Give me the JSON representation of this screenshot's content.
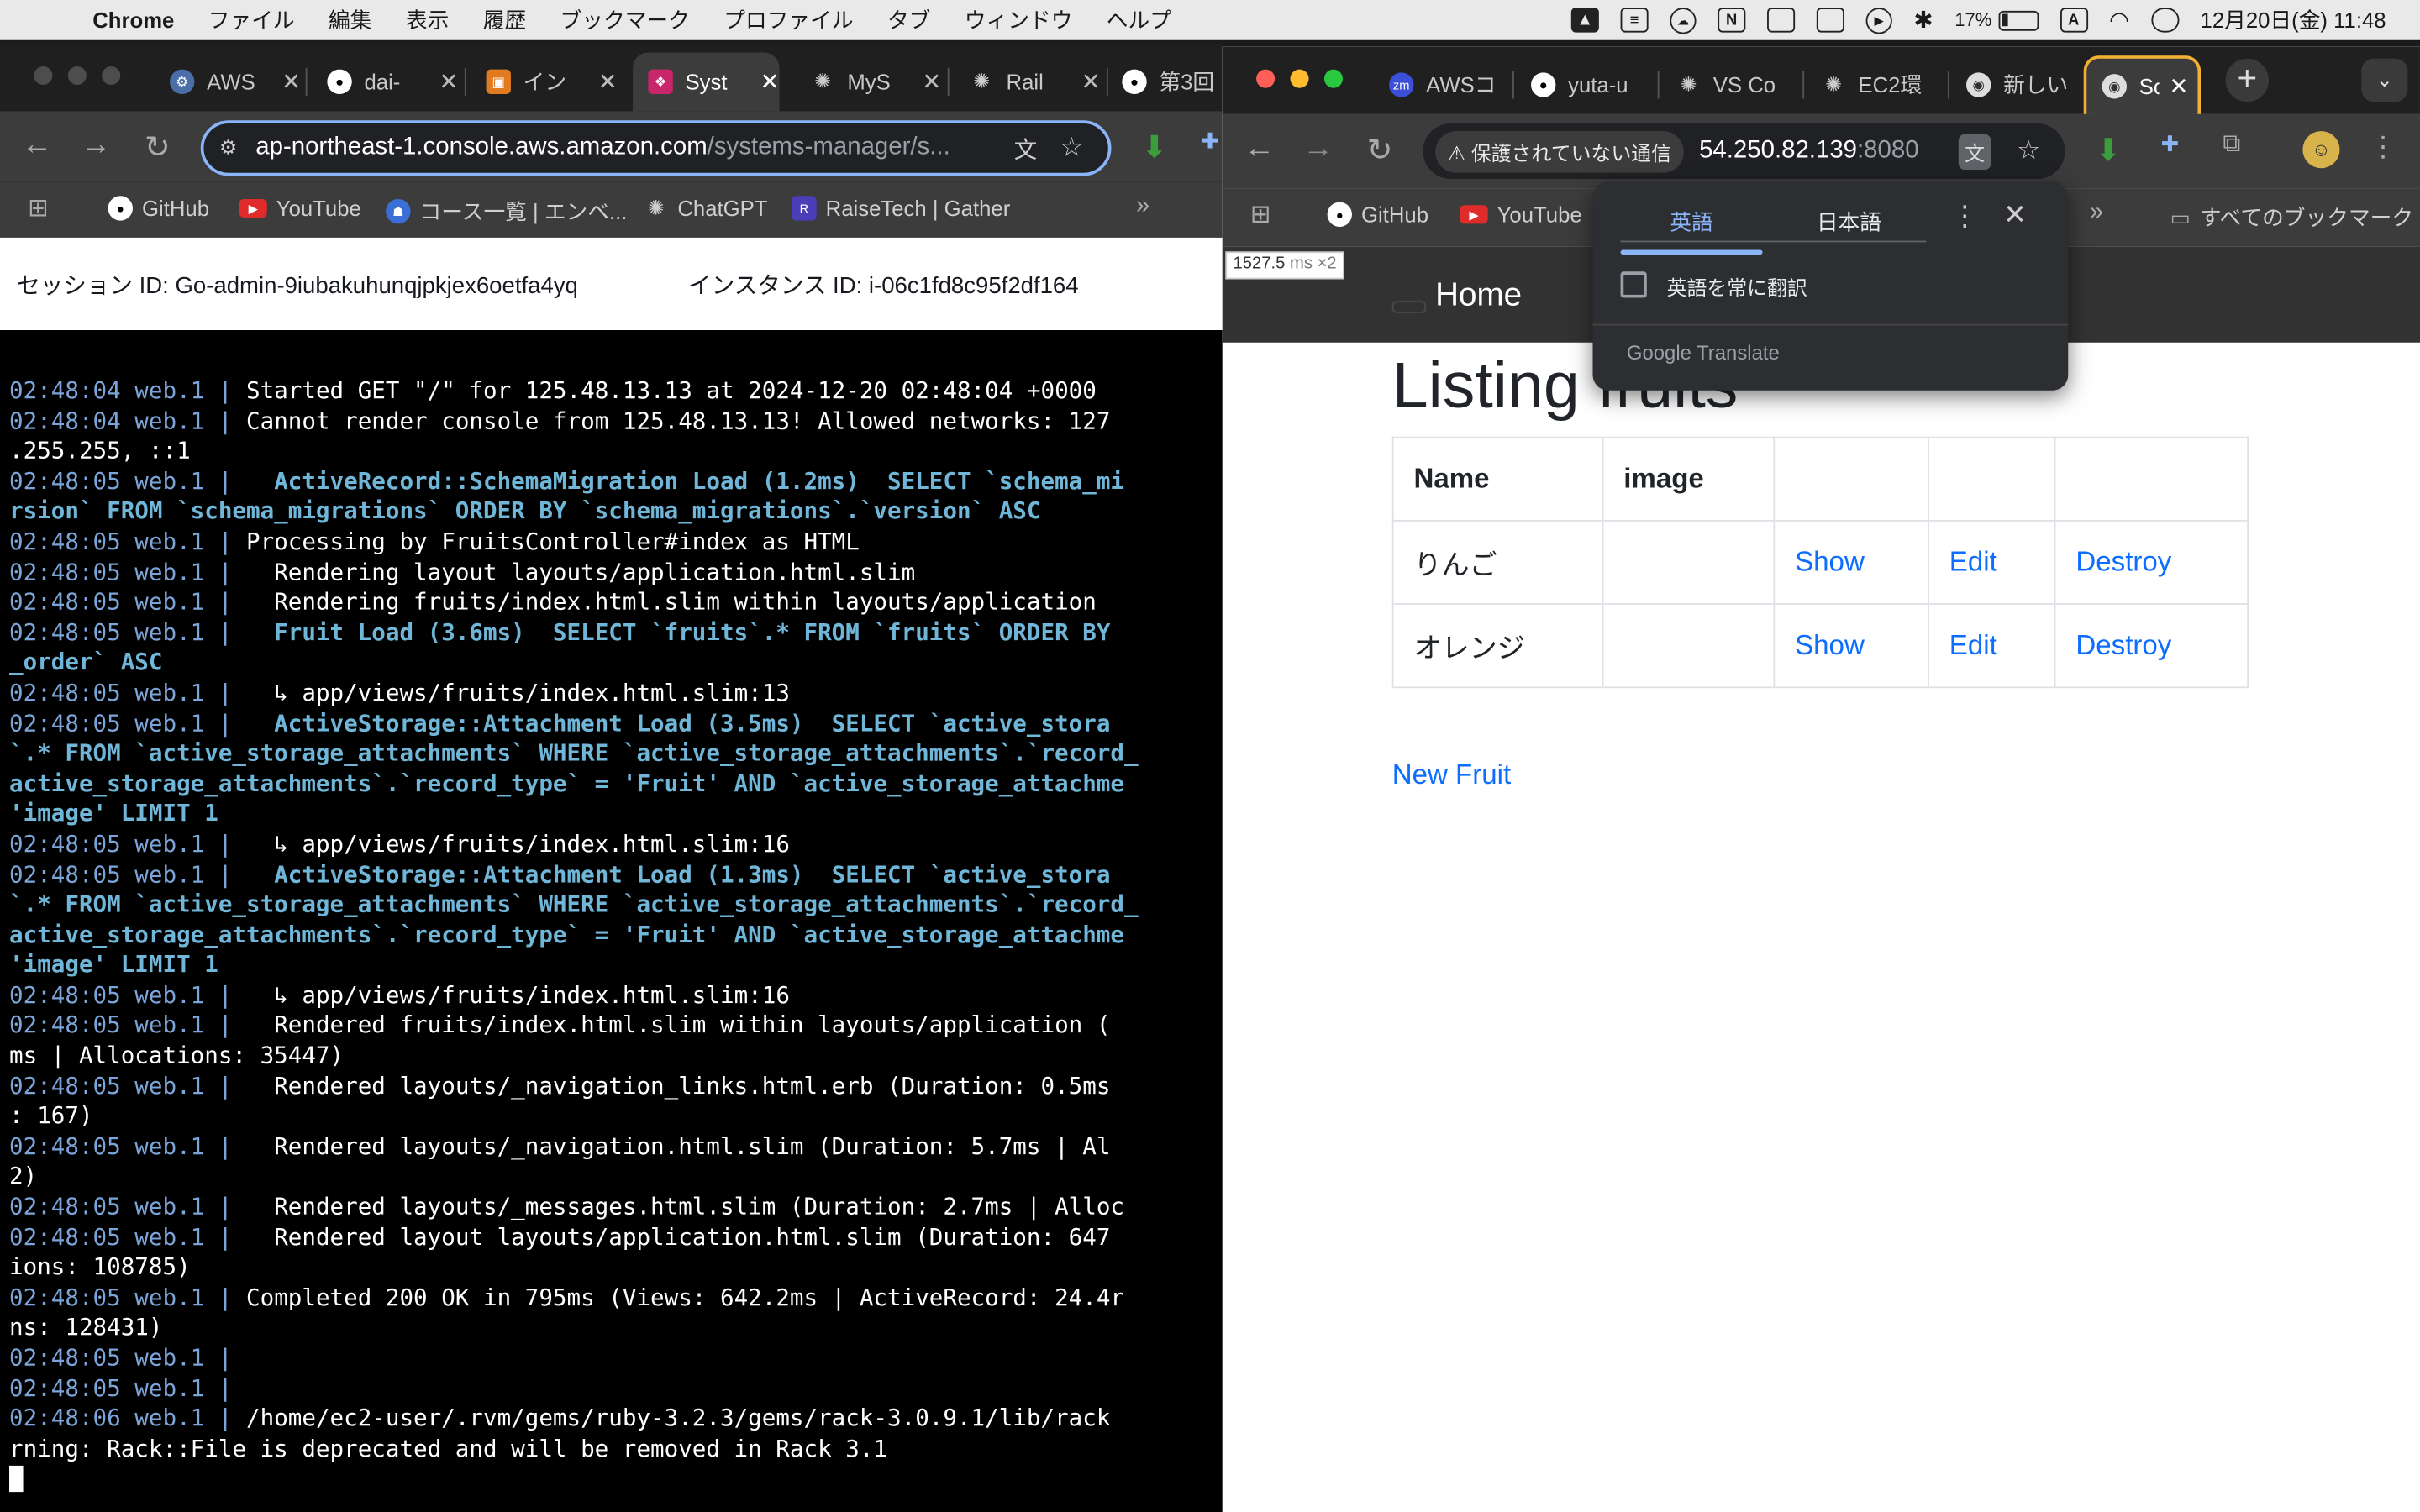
{
  "menubar": {
    "app_name": "Chrome",
    "items": [
      "ファイル",
      "編集",
      "表示",
      "履歴",
      "ブックマーク",
      "プロファイル",
      "タブ",
      "ウィンドウ",
      "ヘルプ"
    ],
    "battery_percent": "17%",
    "input_mode": "A",
    "clock": "12月20日(金) 11:48"
  },
  "left_window": {
    "tabs": [
      {
        "title": "AWS",
        "icon": "aws-systems-manager-icon",
        "color": "#4b6ea8"
      },
      {
        "title": "dai-",
        "icon": "github-icon",
        "color": "#ffffff"
      },
      {
        "title": "イン",
        "icon": "ec2-icon",
        "color": "#e07b22"
      },
      {
        "title": "Syst",
        "icon": "systems-manager-icon",
        "color": "#c9256a"
      },
      {
        "title": "MyS",
        "icon": "chatgpt-icon",
        "color": "#cccccc"
      },
      {
        "title": "Rail",
        "icon": "chatgpt-icon",
        "color": "#cccccc"
      },
      {
        "title": "第3回",
        "icon": "github-icon",
        "color": "#ffffff"
      }
    ],
    "active_tab_index": 3,
    "address_host": "ap-northeast-1.console.aws.amazon.com",
    "address_path": "/systems-manager/s...",
    "bookmarks": [
      {
        "label": "GitHub",
        "icon": "github-icon",
        "color": "#333333"
      },
      {
        "label": "YouTube",
        "icon": "youtube-icon",
        "color": "#e02b2b"
      },
      {
        "label": "コース一覧 | エンベ...",
        "icon": "course-icon",
        "color": "#3b6fd8"
      },
      {
        "label": "ChatGPT",
        "icon": "chatgpt-icon",
        "color": "#555555"
      },
      {
        "label": "RaiseTech | Gather",
        "icon": "raisetech-icon",
        "color": "#4a3fb8"
      }
    ],
    "session_id": "セッション ID: Go-admin-9iubakuhunqjpkjex6oetfa4yq",
    "instance_id": "インスタンス ID: i-06c1fd8c95f2df164"
  },
  "terminal": {
    "lines": [
      {
        "ts": "02:48:04 web.1",
        "sep": " | ",
        "text": "Started GET \"/\" for 125.48.13.13 at 2024-12-20 02:48:04 +0000"
      },
      {
        "ts": "02:48:04 web.1",
        "sep": " | ",
        "text": "Cannot render console from 125.48.13.13! Allowed networks: 127"
      },
      {
        "ts": "",
        "sep": "",
        "text": ".255.255, ::1"
      },
      {
        "ts": "02:48:05 web.1",
        "sep": " | ",
        "text": "  ",
        "sql": "ActiveRecord::SchemaMigration Load (1.2ms)  SELECT `schema_mi"
      },
      {
        "ts": "",
        "sep": "",
        "text": "",
        "sql": "rsion` FROM `schema_migrations` ORDER BY `schema_migrations`.`version` ASC"
      },
      {
        "ts": "02:48:05 web.1",
        "sep": " | ",
        "text": "Processing by FruitsController#index as HTML"
      },
      {
        "ts": "02:48:05 web.1",
        "sep": " | ",
        "text": "  Rendering layout layouts/application.html.slim"
      },
      {
        "ts": "02:48:05 web.1",
        "sep": " | ",
        "text": "  Rendering fruits/index.html.slim within layouts/application"
      },
      {
        "ts": "02:48:05 web.1",
        "sep": " | ",
        "text": "  ",
        "sql": "Fruit Load (3.6ms)  SELECT `fruits`.* FROM `fruits` ORDER BY"
      },
      {
        "ts": "",
        "sep": "",
        "text": "",
        "sql": "_order` ASC"
      },
      {
        "ts": "02:48:05 web.1",
        "sep": " | ",
        "text": "  ↳ app/views/fruits/index.html.slim:13"
      },
      {
        "ts": "02:48:05 web.1",
        "sep": " | ",
        "text": "  ",
        "sql": "ActiveStorage::Attachment Load (3.5ms)  SELECT `active_stora"
      },
      {
        "ts": "",
        "sep": "",
        "text": "",
        "sql": "`.* FROM `active_storage_attachments` WHERE `active_storage_attachments`.`record_"
      },
      {
        "ts": "",
        "sep": "",
        "text": "",
        "sql": "active_storage_attachments`.`record_type` = 'Fruit' AND `active_storage_attachme"
      },
      {
        "ts": "",
        "sep": "",
        "text": "",
        "sql": "'image' LIMIT 1"
      },
      {
        "ts": "02:48:05 web.1",
        "sep": " | ",
        "text": "  ↳ app/views/fruits/index.html.slim:16"
      },
      {
        "ts": "02:48:05 web.1",
        "sep": " | ",
        "text": "  ",
        "sql": "ActiveStorage::Attachment Load (1.3ms)  SELECT `active_stora"
      },
      {
        "ts": "",
        "sep": "",
        "text": "",
        "sql": "`.* FROM `active_storage_attachments` WHERE `active_storage_attachments`.`record_"
      },
      {
        "ts": "",
        "sep": "",
        "text": "",
        "sql": "active_storage_attachments`.`record_type` = 'Fruit' AND `active_storage_attachme"
      },
      {
        "ts": "",
        "sep": "",
        "text": "",
        "sql": "'image' LIMIT 1"
      },
      {
        "ts": "02:48:05 web.1",
        "sep": " | ",
        "text": "  ↳ app/views/fruits/index.html.slim:16"
      },
      {
        "ts": "02:48:05 web.1",
        "sep": " | ",
        "text": "  Rendered fruits/index.html.slim within layouts/application ("
      },
      {
        "ts": "",
        "sep": "",
        "text": "ms | Allocations: 35447)"
      },
      {
        "ts": "02:48:05 web.1",
        "sep": " | ",
        "text": "  Rendered layouts/_navigation_links.html.erb (Duration: 0.5ms"
      },
      {
        "ts": "",
        "sep": "",
        "text": ": 167)"
      },
      {
        "ts": "02:48:05 web.1",
        "sep": " | ",
        "text": "  Rendered layouts/_navigation.html.slim (Duration: 5.7ms | Al"
      },
      {
        "ts": "",
        "sep": "",
        "text": "2)"
      },
      {
        "ts": "02:48:05 web.1",
        "sep": " | ",
        "text": "  Rendered layouts/_messages.html.slim (Duration: 2.7ms | Alloc"
      },
      {
        "ts": "02:48:05 web.1",
        "sep": " | ",
        "text": "  Rendered layout layouts/application.html.slim (Duration: 647"
      },
      {
        "ts": "",
        "sep": "",
        "text": "ions: 108785)"
      },
      {
        "ts": "02:48:05 web.1",
        "sep": " | ",
        "text": "Completed 200 OK in 795ms (Views: 642.2ms | ActiveRecord: 24.4r"
      },
      {
        "ts": "",
        "sep": "",
        "text": "ns: 128431)"
      },
      {
        "ts": "02:48:05 web.1",
        "sep": " | ",
        "text": ""
      },
      {
        "ts": "02:48:05 web.1",
        "sep": " | ",
        "text": ""
      },
      {
        "ts": "02:48:06 web.1",
        "sep": " | ",
        "text": "/home/ec2-user/.rvm/gems/ruby-3.2.3/gems/rack-3.0.9.1/lib/rack"
      },
      {
        "ts": "",
        "sep": "",
        "text": "rning: Rack::File is deprecated and will be removed in Rack 3.1"
      }
    ]
  },
  "right_window": {
    "tabs": [
      {
        "title": "AWSコ",
        "icon": "zoom-icon",
        "color": "#3b4fd8"
      },
      {
        "title": "yuta-u",
        "icon": "github-icon",
        "color": "#ffffff"
      },
      {
        "title": "VS Co",
        "icon": "chatgpt-icon",
        "color": "#cccccc"
      },
      {
        "title": "EC2環",
        "icon": "chatgpt-icon",
        "color": "#cccccc"
      },
      {
        "title": "新しい",
        "icon": "chrome-icon",
        "color": "#dddddd"
      },
      {
        "title": "So",
        "icon": "chrome-icon",
        "color": "#dddddd"
      }
    ],
    "active_tab_index": 5,
    "security_label": "保護されていない通信",
    "address_host": "54.250.82.139",
    "address_port": ":8080",
    "bookmarks": [
      {
        "label": "GitHub",
        "icon": "github-icon",
        "color": "#333333"
      },
      {
        "label": "YouTube",
        "icon": "youtube-icon",
        "color": "#e02b2b"
      }
    ],
    "all_bookmarks_label": "すべてのブックマーク"
  },
  "translate_popup": {
    "source_tab": "英語",
    "target_tab": "日本語",
    "always_translate_label": "英語を常に翻訳",
    "always_translate_checked": false,
    "provider": "Google Translate"
  },
  "page": {
    "timing_value": "1527.5",
    "timing_unit": "ms",
    "timing_close": "×2",
    "nav_home": "Home",
    "title": "Listing fruits",
    "table": {
      "headers": [
        "Name",
        "image",
        "",
        "",
        ""
      ],
      "rows": [
        {
          "name": "りんご",
          "image": "",
          "show": "Show",
          "edit": "Edit",
          "destroy": "Destroy"
        },
        {
          "name": "オレンジ",
          "image": "",
          "show": "Show",
          "edit": "Edit",
          "destroy": "Destroy"
        }
      ]
    },
    "new_link": "New Fruit"
  }
}
